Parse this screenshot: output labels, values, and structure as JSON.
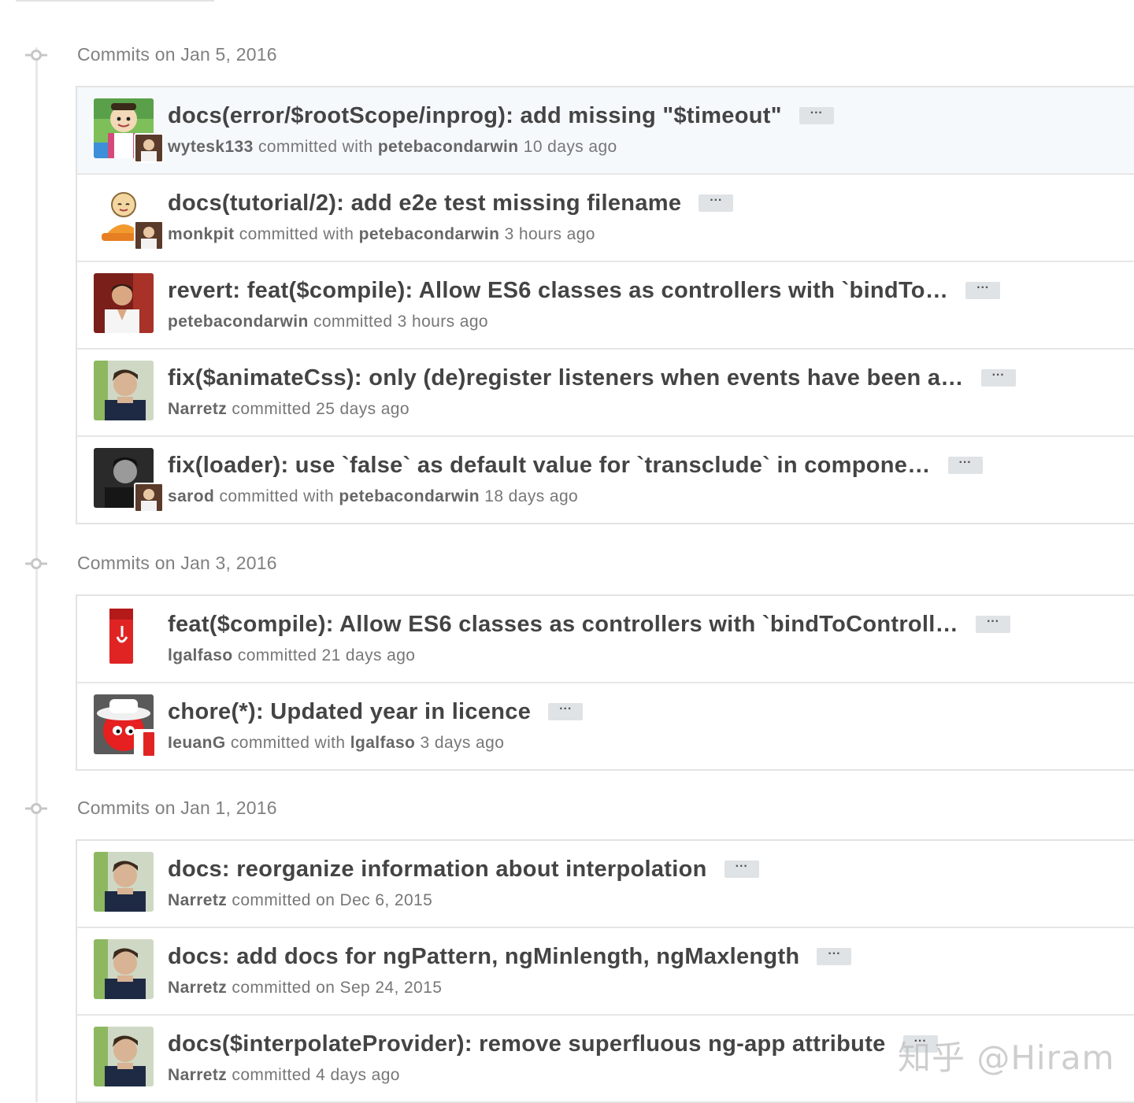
{
  "groups": [
    {
      "title": "Commits on Jan 5, 2016",
      "commits": [
        {
          "title": "docs(error/$rootScope/inprog): add missing \"$timeout\"",
          "author": "wytesk133",
          "verb": "committed with",
          "coauthor": "petebacondarwin",
          "time": "10 days ago",
          "avatar": "cartoon-avatar",
          "highlight": true
        },
        {
          "title": "docs(tutorial/2): add e2e test missing filename",
          "author": "monkpit",
          "verb": "committed with",
          "coauthor": "petebacondarwin",
          "time": "3 hours ago",
          "avatar": "monk-avatar"
        },
        {
          "title": "revert: feat($compile): Allow ES6 classes as controllers with `bindTo…",
          "author": "petebacondarwin",
          "verb": "committed",
          "coauthor": "",
          "time": "3 hours ago",
          "avatar": "photo-avatar"
        },
        {
          "title": "fix($animateCss): only (de)register listeners when events have been a…",
          "author": "Narretz",
          "verb": "committed",
          "coauthor": "",
          "time": "25 days ago",
          "avatar": "narretz-avatar"
        },
        {
          "title": "fix(loader): use `false` as default value for `transclude` in compone…",
          "author": "sarod",
          "verb": "committed with",
          "coauthor": "petebacondarwin",
          "time": "18 days ago",
          "avatar": "bw-photo-avatar"
        }
      ]
    },
    {
      "title": "Commits on Jan 3, 2016",
      "commits": [
        {
          "title": "feat($compile): Allow ES6 classes as controllers with `bindToControll…",
          "author": "lgalfaso",
          "verb": "committed",
          "coauthor": "",
          "time": "21 days ago",
          "avatar": "red-card-avatar"
        },
        {
          "title": "chore(*): Updated year in licence",
          "author": "IeuanG",
          "verb": "committed with",
          "coauthor": "lgalfaso",
          "time": "3 days ago",
          "avatar": "hat-avatar"
        }
      ]
    },
    {
      "title": "Commits on Jan 1, 2016",
      "commits": [
        {
          "title": "docs: reorganize information about interpolation",
          "author": "Narretz",
          "verb": "committed",
          "coauthor": "",
          "time": "on Dec 6, 2015",
          "avatar": "narretz-avatar"
        },
        {
          "title": "docs: add docs for ngPattern, ngMinlength, ngMaxlength",
          "author": "Narretz",
          "verb": "committed",
          "coauthor": "",
          "time": "on Sep 24, 2015",
          "avatar": "narretz-avatar"
        },
        {
          "title": "docs($interpolateProvider): remove superfluous ng-app attribute",
          "author": "Narretz",
          "verb": "committed",
          "coauthor": "",
          "time": "4 days ago",
          "avatar": "narretz-avatar"
        }
      ]
    }
  ],
  "ellipsis_label": "···",
  "watermark": "知乎 @Hiram"
}
